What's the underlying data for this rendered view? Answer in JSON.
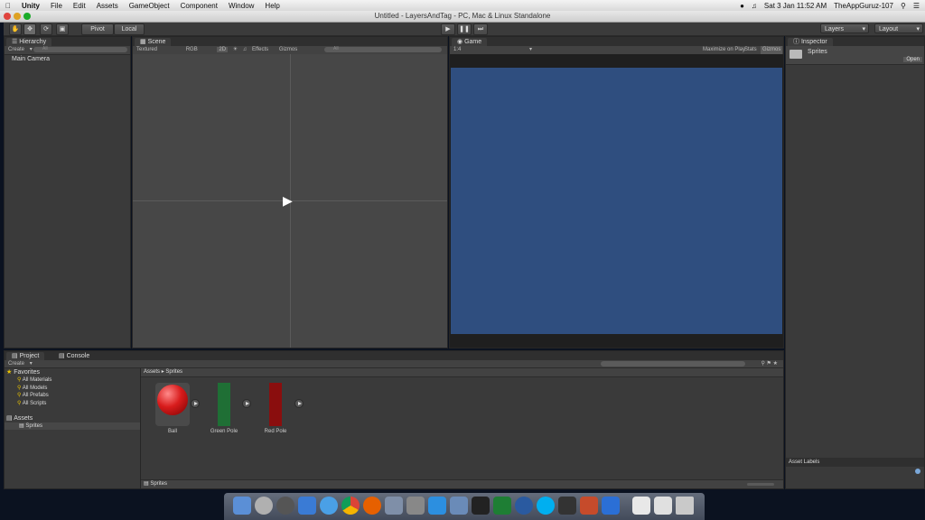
{
  "menubar": {
    "app": "Unity",
    "items": [
      "File",
      "Edit",
      "Assets",
      "GameObject",
      "Component",
      "Window",
      "Help"
    ],
    "clock": "Sat 3 Jan  11:52 AM",
    "user": "TheAppGuruz-107"
  },
  "window": {
    "title": "Untitled - LayersAndTag - PC, Mac & Linux Standalone"
  },
  "toolbar": {
    "pivot": "Pivot",
    "local": "Local",
    "layers": "Layers",
    "layout": "Layout"
  },
  "hierarchy": {
    "tab": "Hierarchy",
    "create": "Create",
    "search_placeholder": "All",
    "items": [
      "Main Camera"
    ]
  },
  "scene": {
    "tab": "Scene",
    "textured": "Textured",
    "rgb": "RGB",
    "mode_2d": "2D",
    "effects": "Effects",
    "gizmos": "Gizmos",
    "search_placeholder": "All"
  },
  "game": {
    "tab": "Game",
    "aspect": "1:4",
    "maximize": "Maximize on Play",
    "stats": "Stats",
    "gizmos": "Gizmos",
    "screen_color": "#2f4e7f"
  },
  "inspector": {
    "tab": "Inspector",
    "selected": "Sprites",
    "open": "Open",
    "asset_labels": "Asset Labels"
  },
  "project": {
    "tab_project": "Project",
    "tab_console": "Console",
    "create": "Create",
    "favorites": "Favorites",
    "favorite_items": [
      "All Materials",
      "All Models",
      "All Prefabs",
      "All Scripts"
    ],
    "assets": "Assets",
    "asset_folders": [
      "Sprites"
    ],
    "breadcrumb_root": "Assets",
    "breadcrumb_current": "Sprites",
    "footer": "Sprites",
    "items": [
      {
        "name": "Ball",
        "color": "#d81c1c"
      },
      {
        "name": "Green Pole",
        "color": "#1f6f35"
      },
      {
        "name": "Red Pole",
        "color": "#8a0e0e"
      }
    ]
  }
}
